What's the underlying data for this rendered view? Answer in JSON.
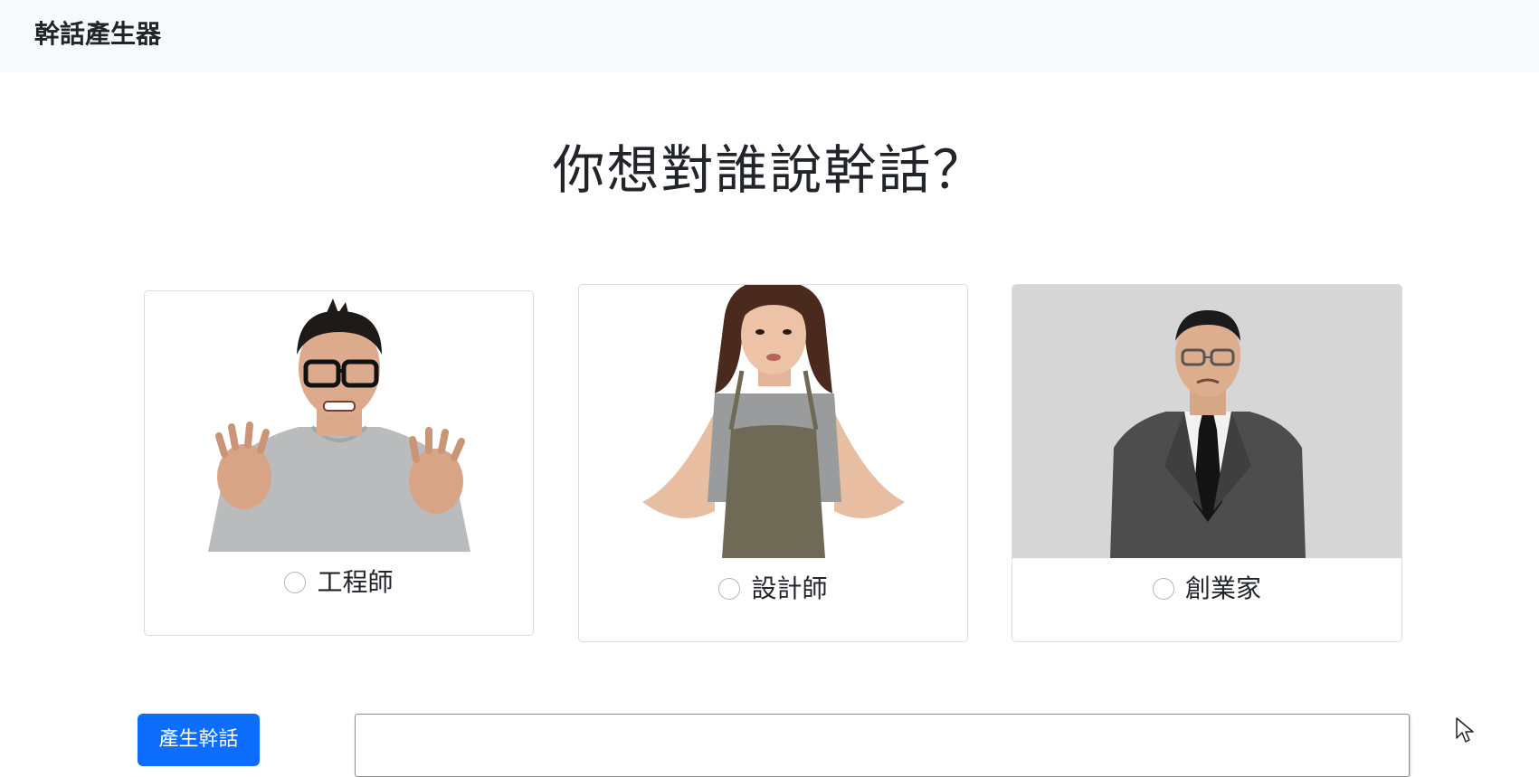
{
  "navbar": {
    "brand": "幹話產生器"
  },
  "main": {
    "heading": "你想對誰說幹話？",
    "targets": [
      {
        "label": "工程師",
        "selected": false,
        "image_icon": "engineer-photo"
      },
      {
        "label": "設計師",
        "selected": false,
        "image_icon": "designer-photo"
      },
      {
        "label": "創業家",
        "selected": false,
        "image_icon": "entrepreneur-photo"
      }
    ],
    "generate_label": "產生幹話",
    "output_value": ""
  },
  "colors": {
    "primary": "#0d6efd",
    "navbar_bg": "#f8f9fa",
    "card_border": "#dcdcdc",
    "text": "#212529"
  }
}
